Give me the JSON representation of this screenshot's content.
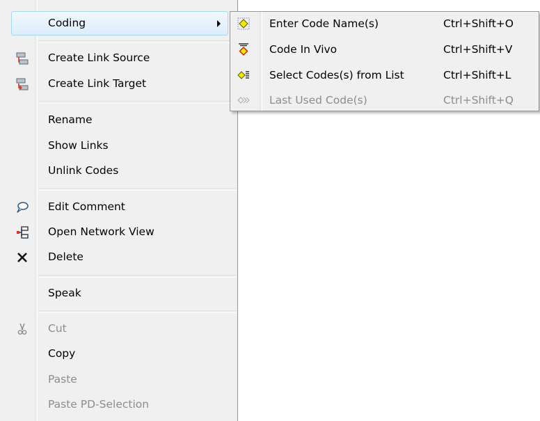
{
  "context_menu": {
    "items": [
      {
        "label": "Coding",
        "icon": "",
        "enabled": true,
        "submenu": true
      },
      {
        "label": "Create Link Source",
        "icon": "link-source-icon",
        "enabled": true
      },
      {
        "label": "Create Link Target",
        "icon": "link-target-icon",
        "enabled": true
      },
      {
        "label": "Rename",
        "enabled": true
      },
      {
        "label": "Show Links",
        "enabled": true
      },
      {
        "label": "Unlink Codes",
        "enabled": true
      },
      {
        "label": "Edit Comment",
        "icon": "comment-bubble-icon",
        "enabled": true
      },
      {
        "label": "Open Network View",
        "icon": "network-view-icon",
        "enabled": true
      },
      {
        "label": "Delete",
        "icon": "delete-x-icon",
        "enabled": true
      },
      {
        "label": "Speak",
        "enabled": true
      },
      {
        "label": "Cut",
        "icon": "scissors-icon",
        "enabled": false
      },
      {
        "label": "Copy",
        "enabled": true
      },
      {
        "label": "Paste",
        "enabled": false
      },
      {
        "label": "Paste PD-Selection",
        "enabled": false
      }
    ]
  },
  "coding_submenu": {
    "items": [
      {
        "label": "Enter Code Name(s)",
        "shortcut": "Ctrl+Shift+O",
        "icon": "enter-code-icon",
        "enabled": true
      },
      {
        "label": "Code In Vivo",
        "shortcut": "Ctrl+Shift+V",
        "icon": "code-in-vivo-icon",
        "enabled": true
      },
      {
        "label": "Select Codes(s) from List",
        "shortcut": "Ctrl+Shift+L",
        "icon": "code-from-list-icon",
        "enabled": true
      },
      {
        "label": "Last Used Code(s)",
        "shortcut": "Ctrl+Shift+Q",
        "icon": "last-used-code-icon",
        "enabled": false
      }
    ]
  },
  "colors": {
    "menu_background": "#f0f0f0",
    "highlight_border": "#a8d8eb",
    "disabled_text": "#8d8d8d",
    "icon_yellow": "#f5e800",
    "icon_red": "#e03020"
  }
}
